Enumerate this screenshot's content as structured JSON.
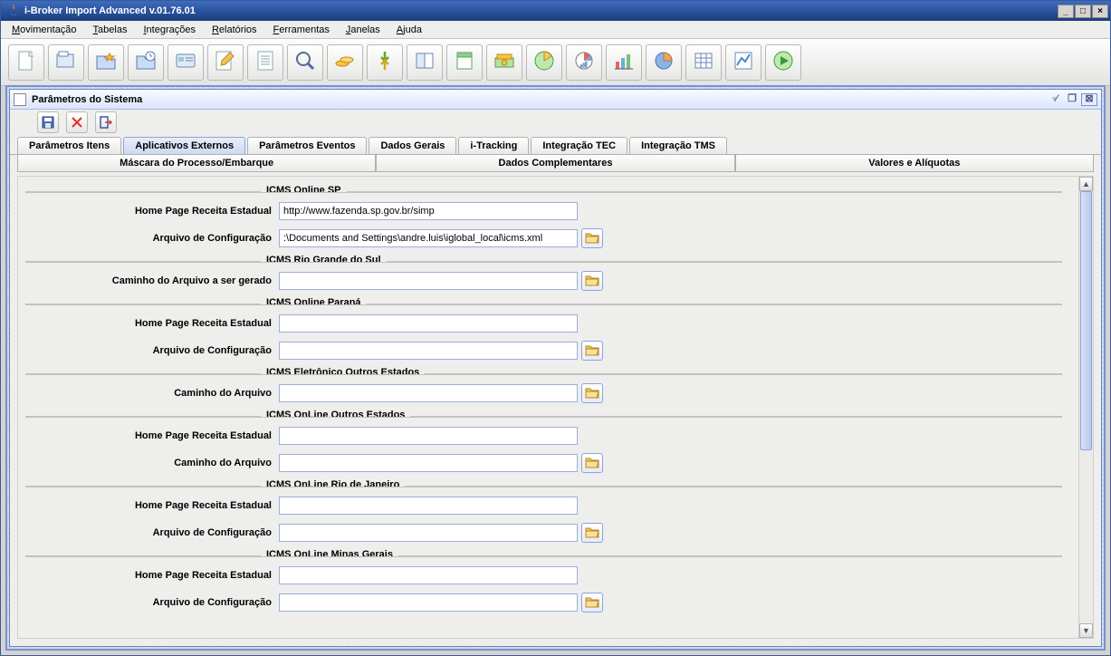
{
  "window": {
    "title": "i-Broker Import Advanced v.01.76.01"
  },
  "menubar": {
    "items": [
      {
        "label": "Movimentação",
        "ul": "M"
      },
      {
        "label": "Tabelas",
        "ul": "T"
      },
      {
        "label": "Integrações",
        "ul": "I"
      },
      {
        "label": "Relatórios",
        "ul": "R"
      },
      {
        "label": "Ferramentas",
        "ul": "F"
      },
      {
        "label": "Janelas",
        "ul": "J"
      },
      {
        "label": "Ajuda",
        "ul": "A"
      }
    ]
  },
  "toolbar_icons": [
    "doc-new",
    "doc-open",
    "folder-star",
    "folder-clock",
    "card",
    "edit-pencil",
    "doc-lines",
    "search-magnifier",
    "coins",
    "arrows-exchange",
    "book-pages",
    "sheet-green",
    "money-stack",
    "chart-green",
    "chart-pie-red",
    "chart-bar-color",
    "pie-blue",
    "table-grid",
    "chart-triangle",
    "play-green"
  ],
  "inner_window": {
    "title": "Parâmetros do Sistema"
  },
  "inner_toolbar": {
    "save": "save",
    "delete": "delete",
    "exit": "exit"
  },
  "tabs_row1": [
    {
      "label": "Parâmetros Itens",
      "active": false
    },
    {
      "label": "Aplicativos Externos",
      "active": true
    },
    {
      "label": "Parâmetros Eventos",
      "active": false
    },
    {
      "label": "Dados Gerais",
      "active": false
    },
    {
      "label": "i-Tracking",
      "active": false
    },
    {
      "label": "Integração TEC",
      "active": false
    },
    {
      "label": "Integração TMS",
      "active": false
    }
  ],
  "tabs_row2": [
    {
      "label": "Máscara do Processo/Embarque"
    },
    {
      "label": "Dados Complementares"
    },
    {
      "label": "Valores e Alíquotas"
    }
  ],
  "groups": [
    {
      "title": "ICMS Online SP",
      "fields": [
        {
          "label": "Home Page Receita Estadual",
          "value": "http://www.fazenda.sp.gov.br/simp",
          "browse": false
        },
        {
          "label": "Arquivo de Configuração",
          "value": ":\\Documents and Settings\\andre.luis\\iglobal_local\\icms.xml",
          "browse": true
        }
      ]
    },
    {
      "title": "ICMS Rio Grande do Sul",
      "fields": [
        {
          "label": "Caminho do Arquivo a ser gerado",
          "value": "",
          "browse": true
        }
      ]
    },
    {
      "title": "ICMS Online Paraná",
      "fields": [
        {
          "label": "Home Page Receita Estadual",
          "value": "",
          "browse": false
        },
        {
          "label": "Arquivo de Configuração",
          "value": "",
          "browse": true
        }
      ]
    },
    {
      "title": "ICMS Eletrônico Outros Estados",
      "fields": [
        {
          "label": "Caminho do Arquivo",
          "value": "",
          "browse": true
        }
      ]
    },
    {
      "title": "ICMS OnLine Outros Estados",
      "fields": [
        {
          "label": "Home Page Receita Estadual",
          "value": "",
          "browse": false
        },
        {
          "label": "Caminho do Arquivo",
          "value": "",
          "browse": true
        }
      ]
    },
    {
      "title": "ICMS OnLine Rio de Janeiro",
      "fields": [
        {
          "label": "Home Page Receita Estadual",
          "value": "",
          "browse": false
        },
        {
          "label": "Arquivo de Configuração",
          "value": "",
          "browse": true
        }
      ]
    },
    {
      "title": "ICMS OnLine Minas Gerais",
      "fields": [
        {
          "label": "Home Page Receita Estadual",
          "value": "",
          "browse": false
        },
        {
          "label": "Arquivo de Configuração",
          "value": "",
          "browse": true
        }
      ]
    }
  ]
}
